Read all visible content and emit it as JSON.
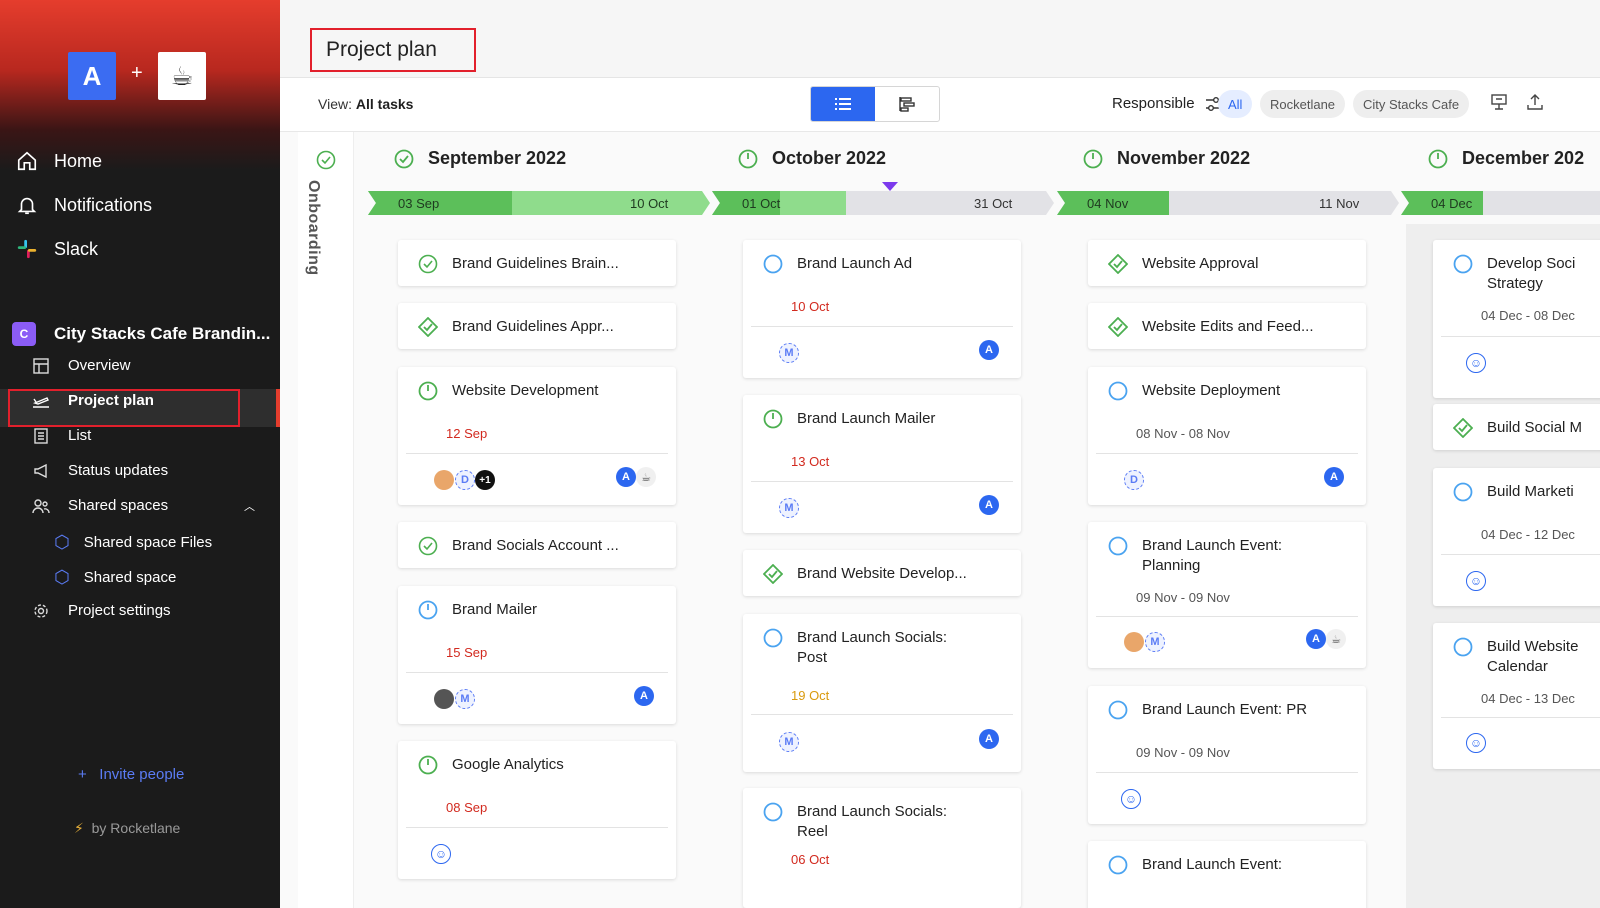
{
  "sidebar": {
    "logo_letter": "A",
    "logo_plus": "+",
    "nav": [
      {
        "label": "Home",
        "icon": "home-icon"
      },
      {
        "label": "Notifications",
        "icon": "bell-icon"
      },
      {
        "label": "Slack",
        "icon": "slack-icon"
      }
    ],
    "project": {
      "badge": "C",
      "name": "City Stacks Cafe Brandin..."
    },
    "project_nav": [
      {
        "label": "Overview",
        "icon": "overview-icon"
      },
      {
        "label": "Project plan",
        "icon": "plane-icon",
        "active": true
      },
      {
        "label": "List",
        "icon": "list-icon"
      },
      {
        "label": "Status updates",
        "icon": "megaphone-icon"
      },
      {
        "label": "Shared spaces",
        "icon": "users-icon"
      }
    ],
    "shared": [
      {
        "label": "Shared space Files"
      },
      {
        "label": "Shared space"
      }
    ],
    "settings": {
      "label": "Project settings"
    },
    "invite": "Invite people",
    "invite_plus": "+",
    "by": "by Rocketlane"
  },
  "header": {
    "title": "Project plan",
    "view_prefix": "View:",
    "view_value": "All tasks",
    "responsible": "Responsible",
    "filters": [
      "All",
      "Rocketlane",
      "City Stacks Cafe"
    ],
    "accent": "#2c67f0"
  },
  "board": {
    "lane": "Onboarding",
    "months": [
      {
        "title": "September 2022",
        "bar_start": "03 Sep",
        "bar_end": "10 Oct"
      },
      {
        "title": "October 2022",
        "bar_start": "01 Oct",
        "bar_end": "31 Oct"
      },
      {
        "title": "November 2022",
        "bar_start": "04 Nov",
        "bar_end": "11 Nov"
      },
      {
        "title": "December 202",
        "bar_start": "04 Dec",
        "bar_end": ""
      }
    ],
    "tasks": {
      "sep": [
        {
          "name": "Brand Guidelines Brain..."
        },
        {
          "name": "Brand Guidelines Appr..."
        },
        {
          "name": "Website Development",
          "due": "12 Sep",
          "extra": "+1"
        },
        {
          "name": "Brand Socials Account ..."
        },
        {
          "name": "Brand Mailer",
          "due": "15 Sep"
        },
        {
          "name": "Google Analytics",
          "due": "08 Sep"
        }
      ],
      "oct": [
        {
          "name": "Brand Launch Ad",
          "due": "10 Oct",
          "av": "M",
          "owner": "A"
        },
        {
          "name": "Brand Launch Mailer",
          "due": "13 Oct",
          "av": "M",
          "owner": "A"
        },
        {
          "name": "Brand Website Develop..."
        },
        {
          "name": "Brand Launch Socials: Post",
          "due": "19 Oct",
          "av": "M",
          "owner": "A"
        },
        {
          "name": "Brand Launch Socials: Reel",
          "due": "06 Oct"
        }
      ],
      "nov": [
        {
          "name": "Website Approval"
        },
        {
          "name": "Website Edits and Feed..."
        },
        {
          "name": "Website Deployment",
          "due": "08 Nov - 08 Nov",
          "av": "D",
          "owner": "A"
        },
        {
          "name": "Brand Launch Event: Planning",
          "due": "09 Nov - 09 Nov",
          "av": "M",
          "owner": "A"
        },
        {
          "name": "Brand Launch Event: PR",
          "due": "09 Nov - 09 Nov"
        },
        {
          "name": "Brand Launch Event:"
        }
      ],
      "dec": [
        {
          "name": "Develop Soci Strategy",
          "due": "04 Dec - 08 Dec"
        },
        {
          "name": "Build Social M"
        },
        {
          "name": "Build Marketi",
          "due": "04 Dec - 12 Dec"
        },
        {
          "name": "Build Website Calendar",
          "due": "04 Dec - 13 Dec"
        }
      ]
    }
  }
}
